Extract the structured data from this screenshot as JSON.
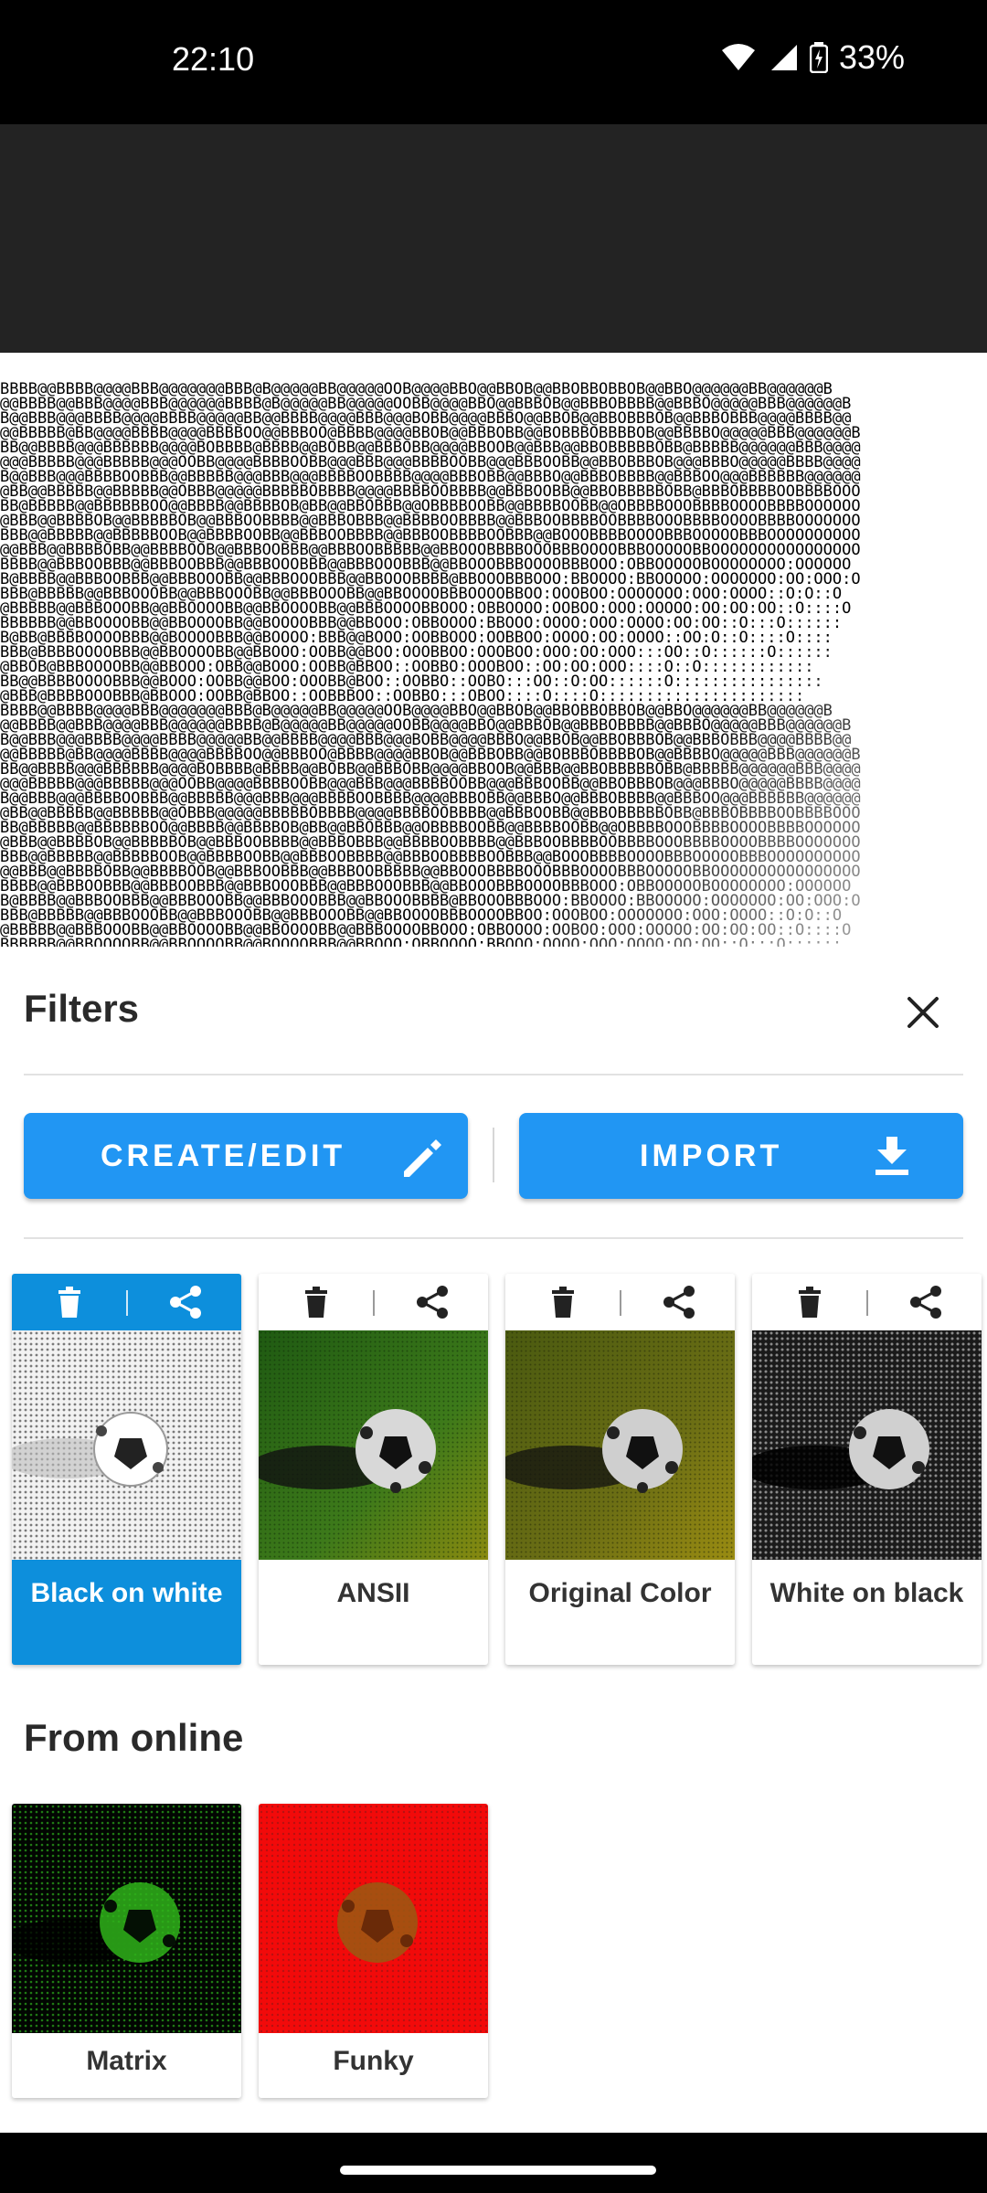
{
  "status": {
    "time": "22:10",
    "battery": "33%"
  },
  "preview": {
    "ascii_rows": [
      "BBBB@@BBBB@@@@BBB@@@@@@@BBB@B@@@@@BB@@@@@OOB@@@@BBO@@BBOB@@BBOBBOBBOB@@BBO@@@@@@BB@@@@@@B",
      "@@BBBB@@BBB@@@@BBB@@@@@@BBBB@B@@@@@BB@@@@@OOBB@@@@BBO@@BBBOB@@BBBOBBBB@@BBBO@@@@@BBB@@@@@@B",
      "B@@BBB@@@BBBB@@@@BBBB@@@@@BB@@BBBB@@@@BBB@@@BOBB@@@@BBBO@@BBOB@@BBOBBBOB@@BBBOBBB@@@@BBBB@@",
      "@@BBBBB@BB@@@@BBBB@@@@BBBBOO@@BBBOO@BBBB@@@@BBOB@@BBBOBB@@BOBBBOBBBBOB@@BBBBO@@@@@BBB@@@@@@B",
      "BB@@BBBB@@@BBBBBB@@@@BOBBBB@BBBB@@BOBB@@BBBOBB@@@@BBOOB@@BBB@@BBOBBBBBOBB@BBBBB@@@@@@BBB@@@@",
      "@@@BBBBB@@@BBBBB@@@OOBB@@@@BBBBOOBB@@@BBB@@@BBBBOOBB@@@BBBOOBB@@BBOBBBOB@@@BBBO@@@@@BBBB@@@@",
      "B@@BBB@@@BBBBOOBBB@@BBBBB@@@BBB@@@BBBBOOBBBB@@@@BBBOBB@@BBBO@@BBBOBBBB@@BBBOO@@@BBBBBB@@@@@@",
      "@BB@@BBBBB@@BBBBB@@OBBB@@@@@BBBBBOBBBB@@@@BBBBOOBBBB@@BBBOOBB@@BBOBBBBBOBB@BBBOBBBBOOBBBBOOO",
      "BB@BBBBB@@BBBBBBOO@@BBBB@@BBBBOB@BB@@BBOBBB@@OBBBBOOBB@@BBBBOOBB@@OBBBBOOOBBBBOOOOBBBBOOOOOO",
      "@BBB@@BBBBOB@@BBBBBOB@@BBBOOBBBB@@BBBOBBB@@BBBBOOBBBB@@BBBOOBBBBOOBBBBOOOBBBBOOOOBBBBOOOOOOO",
      "BBB@@BBBBB@@BBBBBOOB@@BBBBOOBB@@BBBOOBBBB@@BBBOOBBBBOOBBB@@BOOOBBBBOOOOBBBOOOOOBBBOOOOOOOOOO",
      "@@BBB@@BBBBOBB@@BBBBOOB@@BBBOOBBB@@BBBOOBBBBB@@BBOOOBBBBOOOBBBOOOOBBBOOOOOBBOOOOOOOOOOOOOOOO",
      "BBBB@@BBBOOBBB@@BBBOOBBB@@BBBOOOBBB@@BBBOOOBBB@@BBOOOBBBOOOOBBBOOO:OBBOOOOOBOOOOOOOO:OOOOOO",
      "B@BBBB@@BBBOOBBB@@BBBOOOBB@@BBBOOOBBB@@BBOOOBBBB@BBOOOBBBOOO:BBOOOO:BBOOOOO:OOOOOOO:OO:OOO:O",
      "BBB@BBBBB@@BBBOOOBB@@BBBOOOBB@@BBBOOOBB@@BBOOOOBBBOOOOBBOO:OOOBOO:OOOOOOO:OOO:OOOO::O:O::O",
      "@BBBBB@@BBBOOOBB@@BBOOOOBB@@BBOOOOBB@@BBBOOOOBBOOO:OBBOOOO:OOBOO:OOO:OOOOO:OO:OO:OO::O::::O",
      "BBBBBB@@BBOOOOBB@@BBOOOOBB@@BOOOOBBB@@BBOOO:OBBOOOO:BBOOO:OOOO:OOO:OOOO:OO:OO::O:::O::::::",
      "B@BB@BBBBOOOOBBB@@BOOOOBBB@@BOOOO:BBB@@BOOO:OOBBOOO:OOBBOO:OOOO:OO:OOOO::OO:O::O::::O::::",
      "BBB@BBBBOOOOBBB@@BBOOOOBB@@BBOOO:OOBB@@BOO:OOOBBOO:OOOBOO:OOO:OO:OOO:::OO::O::::::O::::::",
      "@BBOB@BBBOOOOBB@@BBOOO:OBB@@BOOO:OOBB@BBOO::OOBBO:OOOBOO::OO:OO:OOO::::O::O::::::::::::",
      "BB@@BBBBOOOOBBB@@BOOO:OOBB@@BOO:OOOBB@BOO::OOBBO::OOBO:::OO::O:OO::::::O::::::::::::::::",
      "@BBB@BBBBOOOBBB@BBOOO:OOBB@BBOO::OOBBBOO::OOBBO:::OBOO::::O::::O::::::::::::::::::::::"
    ]
  },
  "filters": {
    "title": "Filters",
    "create_label": "CREATE/EDIT",
    "import_label": "IMPORT",
    "cards": [
      {
        "name": "Black on white",
        "selected": true
      },
      {
        "name": "ANSII",
        "selected": false
      },
      {
        "name": "Original Color",
        "selected": false
      },
      {
        "name": "White on black",
        "selected": false
      }
    ]
  },
  "online": {
    "title": "From online",
    "cards": [
      {
        "name": "Matrix"
      },
      {
        "name": "Funky"
      }
    ]
  },
  "colors": {
    "accent": "#2196F3",
    "selected_card": "#0D8FDC"
  }
}
